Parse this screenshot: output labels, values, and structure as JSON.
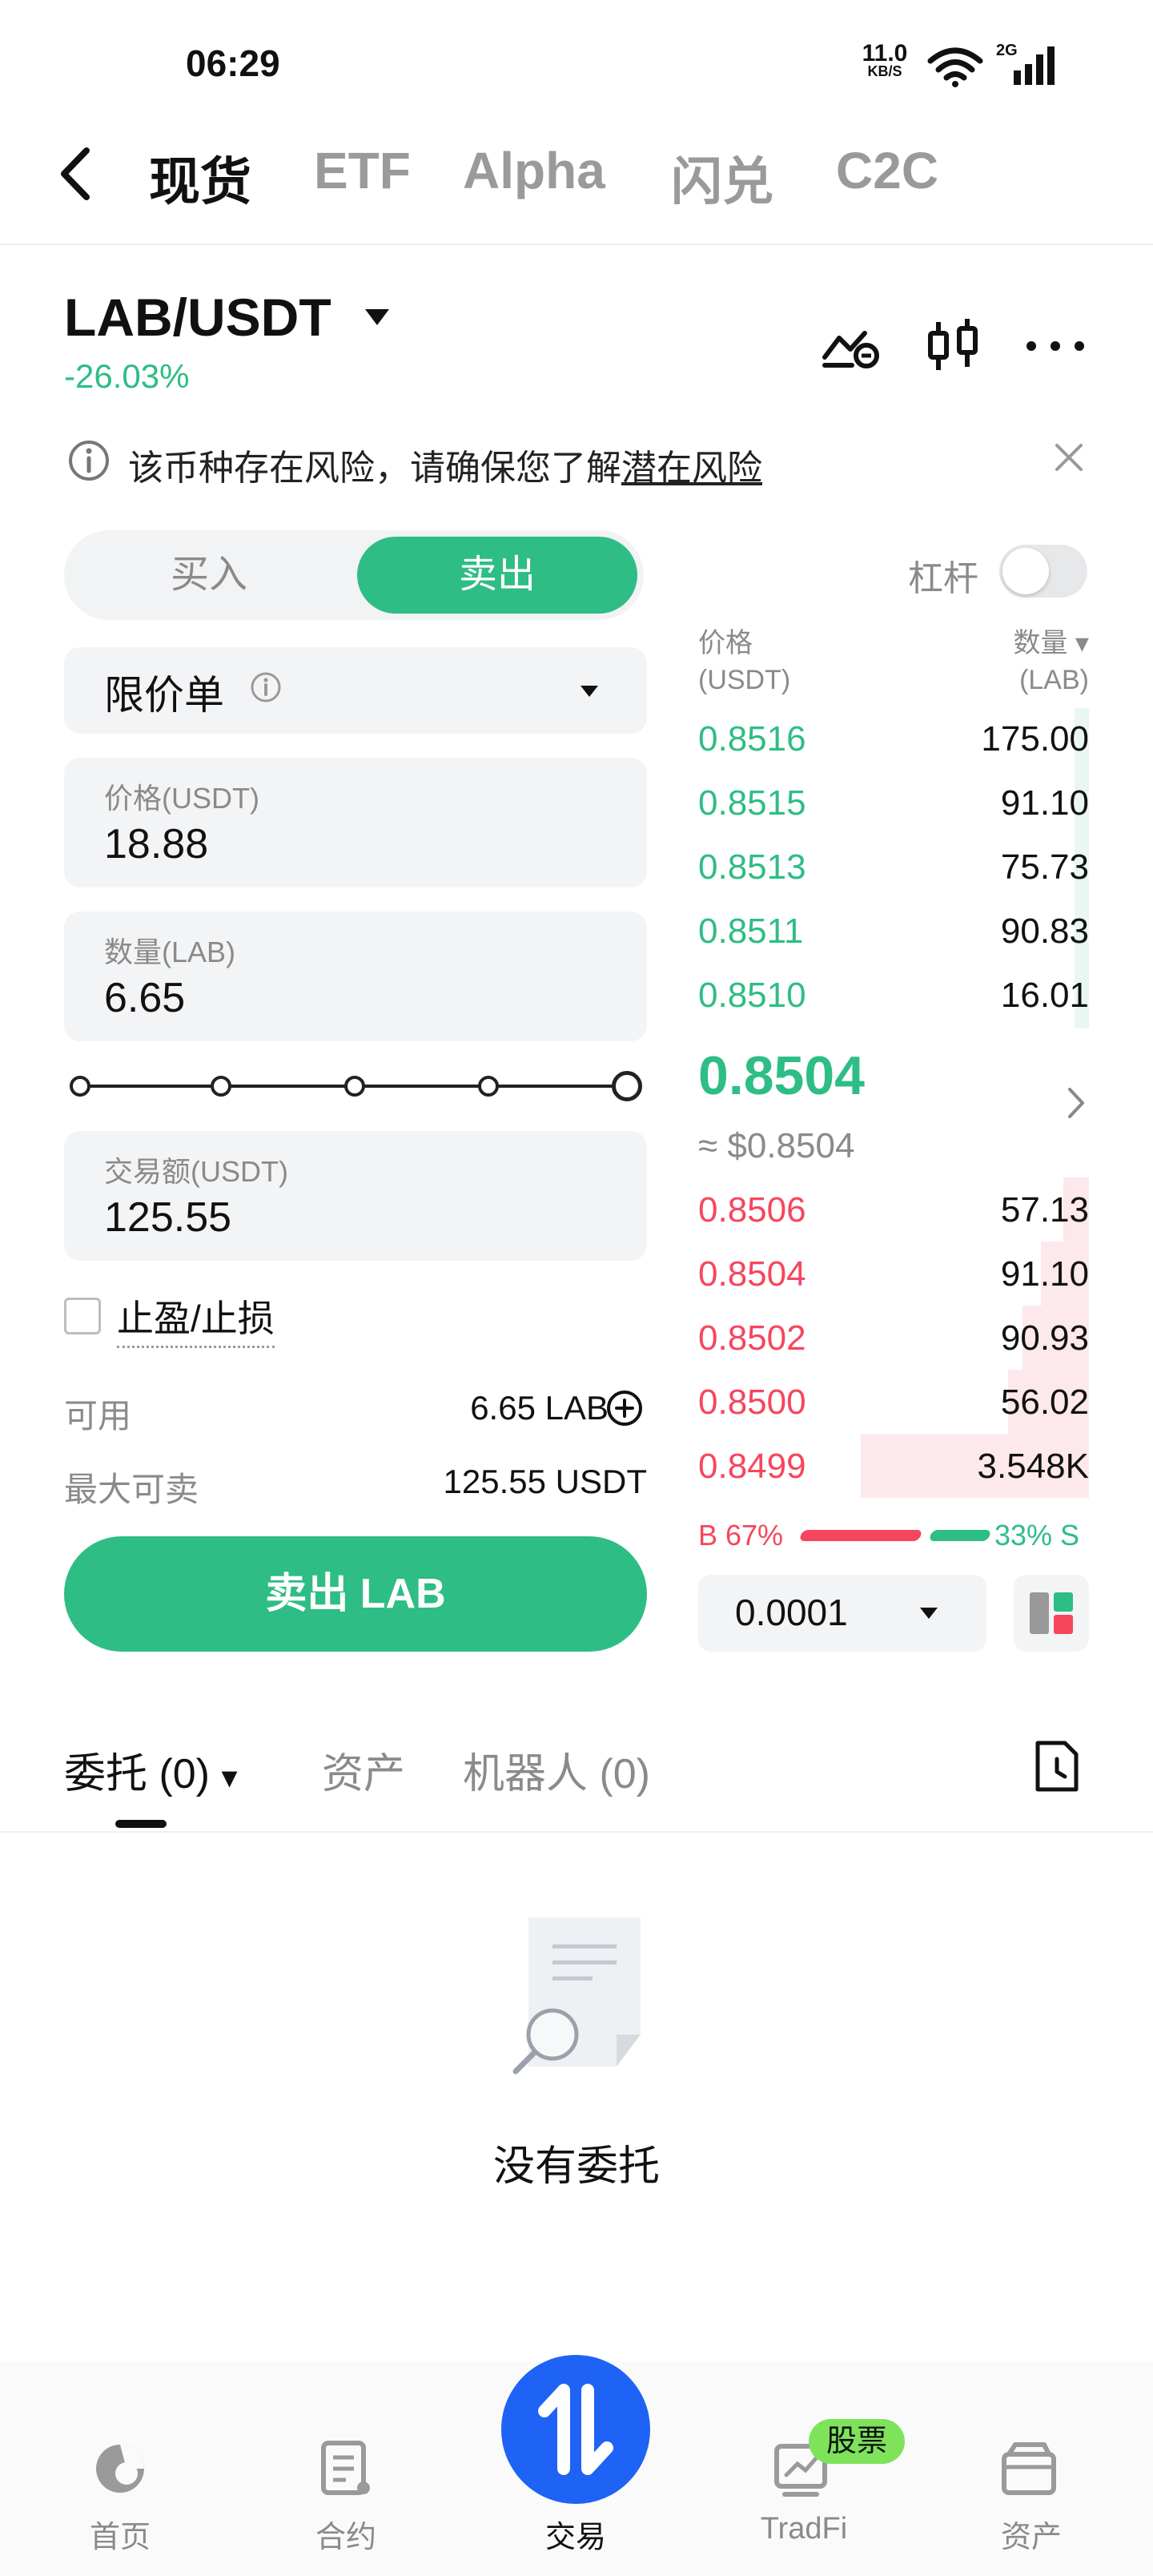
{
  "status": {
    "time": "06:29",
    "speed": "11.0",
    "speed_unit": "KB/S",
    "network": "2G"
  },
  "nav": {
    "tabs": [
      "现货",
      "ETF",
      "Alpha",
      "闪兑",
      "C2C"
    ]
  },
  "pair": {
    "symbol": "LAB/USDT",
    "change": "-26.03%"
  },
  "risk": {
    "text": "该币种存在风险，请确保您了解",
    "link": "潜在风险"
  },
  "switch": {
    "buy": "买入",
    "sell": "卖出"
  },
  "leverage": {
    "label": "杠杆",
    "enabled": false
  },
  "form": {
    "order_type": "限价单",
    "price_label": "价格(USDT)",
    "price": "18.88",
    "qty_label": "数量(LAB)",
    "qty": "6.65",
    "slider_percent": 100,
    "amount_label": "交易额(USDT)",
    "amount": "125.55",
    "tpsl_label": "止盈/止损",
    "available_label": "可用",
    "available": "6.65 LAB",
    "max_sell_label": "最大可卖",
    "max_sell": "125.55 USDT",
    "submit": "卖出 LAB"
  },
  "orderbook": {
    "price_header": "价格",
    "price_unit": "(USDT)",
    "qty_header": "数量",
    "qty_unit": "(LAB)",
    "asks": [
      {
        "price": "0.8516",
        "qty": "175.00",
        "depth": 0.05
      },
      {
        "price": "0.8515",
        "qty": "91.10",
        "depth": 0.05
      },
      {
        "price": "0.8513",
        "qty": "75.73",
        "depth": 0.05
      },
      {
        "price": "0.8511",
        "qty": "90.83",
        "depth": 0.05
      },
      {
        "price": "0.8510",
        "qty": "16.01",
        "depth": 0.05
      }
    ],
    "last_price": "0.8504",
    "last_usd": "≈ $0.8504",
    "bids": [
      {
        "price": "0.8506",
        "qty": "57.13",
        "depth": 0.07
      },
      {
        "price": "0.8504",
        "qty": "91.10",
        "depth": 0.13
      },
      {
        "price": "0.8502",
        "qty": "90.93",
        "depth": 0.18
      },
      {
        "price": "0.8500",
        "qty": "56.02",
        "depth": 0.22
      },
      {
        "price": "0.8499",
        "qty": "3.548K",
        "depth": 0.62
      }
    ],
    "buy_ratio": "B 67%",
    "sell_ratio": "33% S",
    "precision": "0.0001"
  },
  "tabs": {
    "orders": "委托 (0)",
    "assets": "资产",
    "bots": "机器人 (0)"
  },
  "empty": {
    "text": "没有委托"
  },
  "bottom_nav": {
    "home": "首页",
    "futures": "合约",
    "trade": "交易",
    "tradfi": "TradFi",
    "assets": "资产",
    "badge": "股票"
  },
  "colors": {
    "green": "#2ebd85",
    "red": "#f6465d",
    "blue": "#1e63f5"
  }
}
